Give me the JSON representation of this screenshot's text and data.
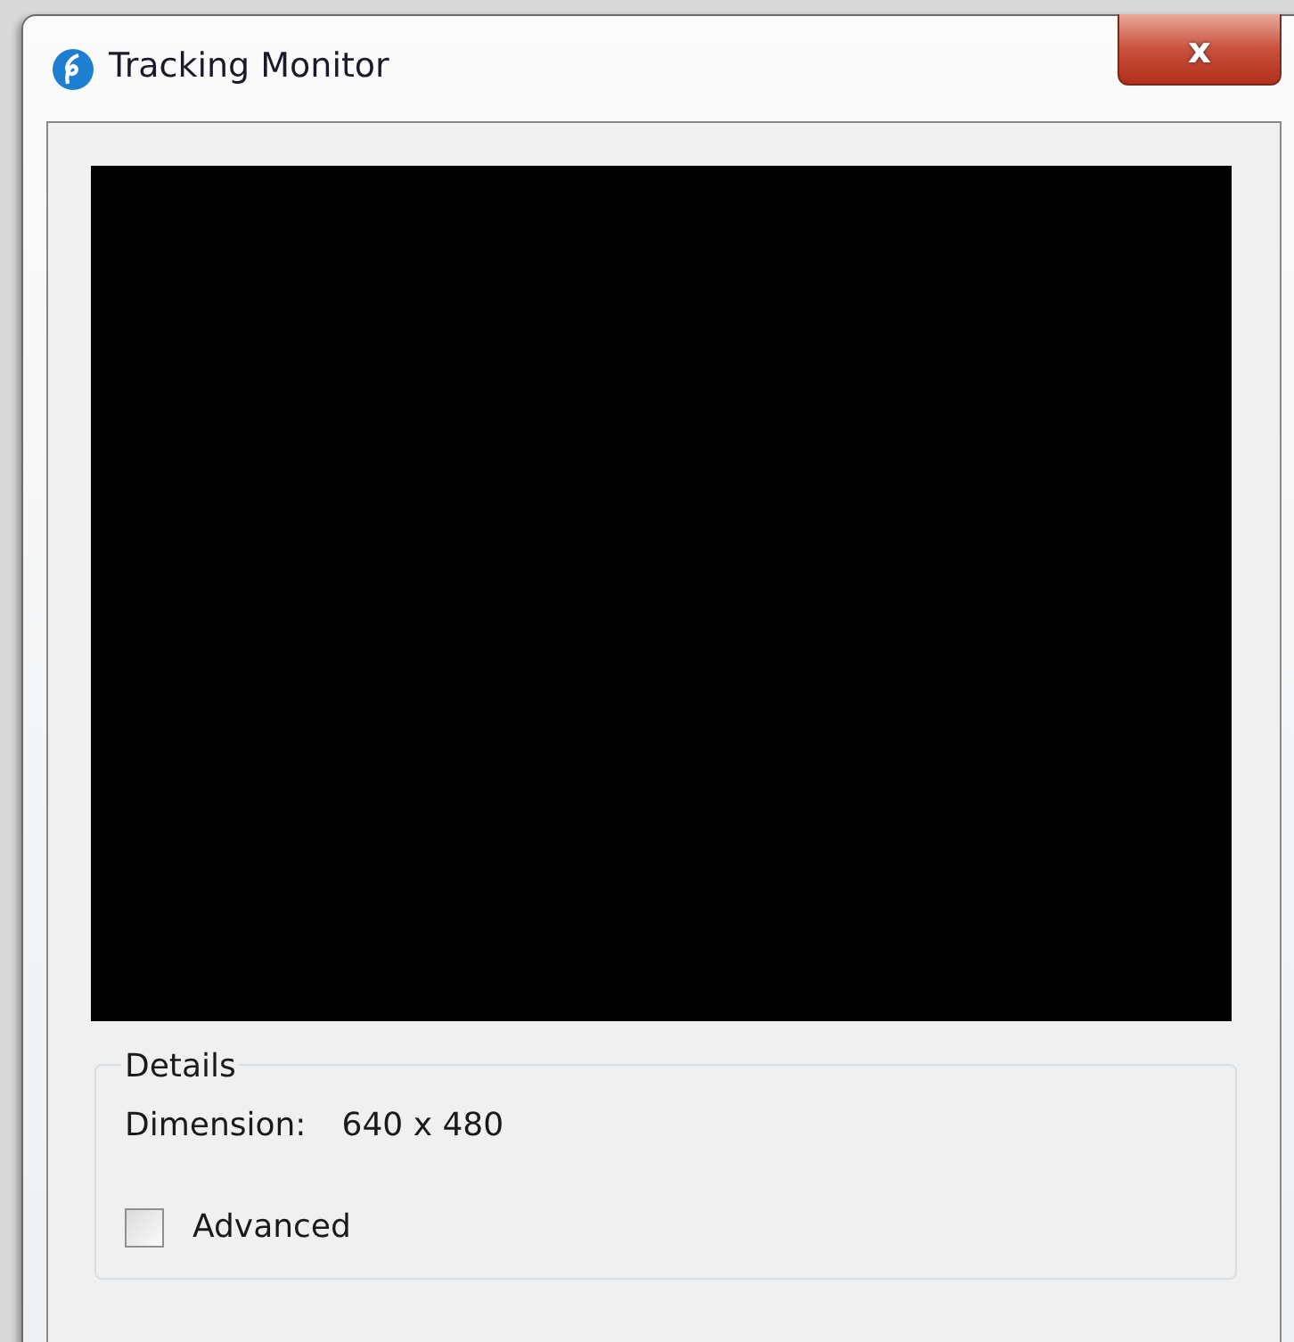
{
  "window": {
    "title": "Tracking Monitor",
    "close_button": "x"
  },
  "details": {
    "legend": "Details",
    "dimension_label": "Dimension:",
    "dimension_value": "640 x 480"
  },
  "advanced": {
    "label": "Advanced",
    "checked": false
  }
}
